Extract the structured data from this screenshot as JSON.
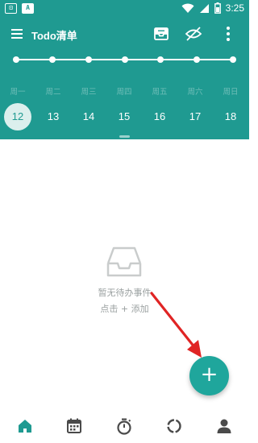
{
  "status_bar": {
    "left_icons": [
      "debug-box-icon",
      "a-box-icon"
    ],
    "left_labels": [
      "⊡",
      "A"
    ],
    "time": "3:25",
    "right_icons": [
      "wifi-icon",
      "signal-icon",
      "battery-icon"
    ]
  },
  "toolbar": {
    "title": "Todo清单",
    "icons": [
      "menu-icon",
      "inbox-icon",
      "eye-off-icon",
      "more-vert-icon"
    ]
  },
  "timeline": {
    "points": 7
  },
  "week": {
    "days": [
      "周一",
      "周二",
      "周三",
      "周四",
      "周五",
      "周六",
      "周日"
    ],
    "dates": [
      "12",
      "13",
      "14",
      "15",
      "16",
      "17",
      "18"
    ],
    "selected_date": "12"
  },
  "empty_state": {
    "icon": "inbox-tray-icon",
    "title": "暂无待办事件",
    "hint": "点击 + 添加"
  },
  "fab": {
    "label": "+"
  },
  "bottom_nav": {
    "items": [
      {
        "icon": "home-icon",
        "active": true
      },
      {
        "icon": "calendar-icon",
        "active": false
      },
      {
        "icon": "timer-icon",
        "active": false
      },
      {
        "icon": "progress-ring-icon",
        "active": false
      },
      {
        "icon": "profile-icon",
        "active": false
      }
    ]
  },
  "colors": {
    "primary": "#1f9a91",
    "fab": "#1fa69c",
    "nav_icon": "#4a4a4a",
    "annotation_arrow": "#e02424"
  }
}
